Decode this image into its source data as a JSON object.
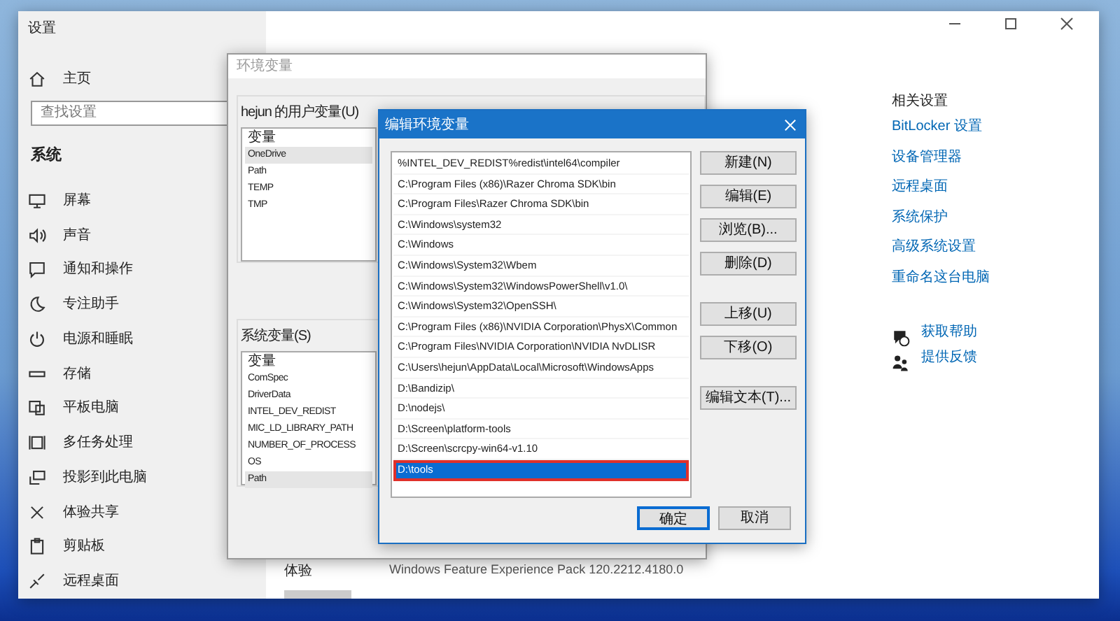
{
  "settings_window": {
    "title": "设置",
    "home": "主页",
    "search": {
      "placeholder": "查找设置"
    },
    "section": "系统",
    "nav_items": [
      "屏幕",
      "声音",
      "通知和操作",
      "专注助手",
      "电源和睡眠",
      "存储",
      "平板电脑",
      "多任务处理",
      "投影到此电脑",
      "体验共享",
      "剪贴板",
      "远程桌面"
    ],
    "related": {
      "heading": "相关设置",
      "links": [
        "BitLocker 设置",
        "设备管理器",
        "远程桌面",
        "系统保护",
        "高级系统设置",
        "重命名这台电脑"
      ]
    },
    "help_links": [
      "获取帮助",
      "提供反馈"
    ],
    "info_rows": [
      {
        "label": "体验",
        "value": "Windows Feature Experience Pack 120.2212.4180.0"
      }
    ]
  },
  "env_dialog": {
    "title": "环境变量",
    "user_vars": {
      "label": "hejun 的用户变量(U)",
      "header": "变量",
      "rows": [
        {
          "name": "OneDrive",
          "selected": true
        },
        {
          "name": "Path",
          "selected": false
        },
        {
          "name": "TEMP",
          "selected": false
        },
        {
          "name": "TMP",
          "selected": false
        }
      ]
    },
    "system_vars": {
      "label": "系统变量(S)",
      "header": "变量",
      "rows": [
        {
          "name": "ComSpec",
          "selected": false
        },
        {
          "name": "DriverData",
          "selected": false
        },
        {
          "name": "INTEL_DEV_REDIST",
          "selected": false
        },
        {
          "name": "MIC_LD_LIBRARY_PATH",
          "selected": false
        },
        {
          "name": "NUMBER_OF_PROCESS",
          "selected": false
        },
        {
          "name": "OS",
          "selected": false
        },
        {
          "name": "Path",
          "selected": true
        }
      ]
    }
  },
  "edit_dialog": {
    "title": "编辑环境变量",
    "paths": [
      {
        "text": "%INTEL_DEV_REDIST%redist\\intel64\\compiler",
        "selected": false,
        "highlighted": false
      },
      {
        "text": "C:\\Program Files (x86)\\Razer Chroma SDK\\bin",
        "selected": false,
        "highlighted": false
      },
      {
        "text": "C:\\Program Files\\Razer Chroma SDK\\bin",
        "selected": false,
        "highlighted": false
      },
      {
        "text": "C:\\Windows\\system32",
        "selected": false,
        "highlighted": false
      },
      {
        "text": "C:\\Windows",
        "selected": false,
        "highlighted": false
      },
      {
        "text": "C:\\Windows\\System32\\Wbem",
        "selected": false,
        "highlighted": false
      },
      {
        "text": "C:\\Windows\\System32\\WindowsPowerShell\\v1.0\\",
        "selected": false,
        "highlighted": false
      },
      {
        "text": "C:\\Windows\\System32\\OpenSSH\\",
        "selected": false,
        "highlighted": false
      },
      {
        "text": "C:\\Program Files (x86)\\NVIDIA Corporation\\PhysX\\Common",
        "selected": false,
        "highlighted": false
      },
      {
        "text": "C:\\Program Files\\NVIDIA Corporation\\NVIDIA NvDLISR",
        "selected": false,
        "highlighted": false
      },
      {
        "text": "C:\\Users\\hejun\\AppData\\Local\\Microsoft\\WindowsApps",
        "selected": false,
        "highlighted": false
      },
      {
        "text": "D:\\Bandizip\\",
        "selected": false,
        "highlighted": false
      },
      {
        "text": "D:\\nodejs\\",
        "selected": false,
        "highlighted": false
      },
      {
        "text": "D:\\Screen\\platform-tools",
        "selected": false,
        "highlighted": false
      },
      {
        "text": "D:\\Screen\\scrcpy-win64-v1.10",
        "selected": false,
        "highlighted": false
      },
      {
        "text": "D:\\tools",
        "selected": true,
        "highlighted": true
      }
    ],
    "side_button_groups": [
      [
        "新建(N)",
        "编辑(E)",
        "浏览(B)...",
        "删除(D)"
      ],
      [
        "上移(U)",
        "下移(O)"
      ],
      [
        "编辑文本(T)..."
      ]
    ],
    "ok": "确定",
    "cancel": "取消"
  }
}
